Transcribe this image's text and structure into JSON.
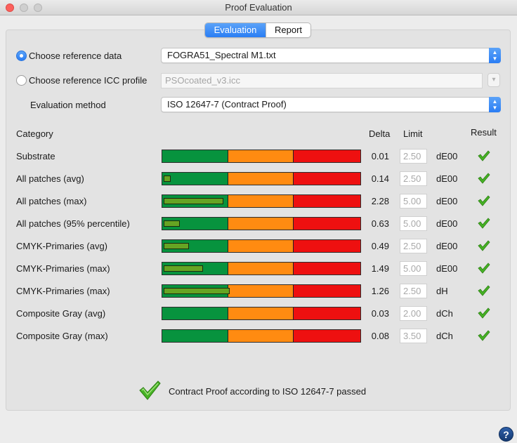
{
  "window": {
    "title": "Proof Evaluation"
  },
  "tabs": [
    {
      "label": "Evaluation",
      "active": true
    },
    {
      "label": "Report",
      "active": false
    }
  ],
  "reference": {
    "data_label": "Choose reference data",
    "data_value": "FOGRA51_Spectral M1.txt",
    "icc_label": "Choose reference ICC profile",
    "icc_value": "PSOcoated_v3.icc",
    "method_label": "Evaluation method",
    "method_value": "ISO 12647-7 (Contract Proof)"
  },
  "table": {
    "headers": {
      "category": "Category",
      "delta": "Delta",
      "limit": "Limit",
      "result": "Result"
    },
    "rows": [
      {
        "category": "Substrate",
        "delta": "0.01",
        "limit": "2.50",
        "unit": "dE00",
        "level": 0.0
      },
      {
        "category": "All patches (avg)",
        "delta": "0.14",
        "limit": "2.50",
        "unit": "dE00",
        "level": 0.034
      },
      {
        "category": "All patches (max)",
        "delta": "2.28",
        "limit": "5.00",
        "unit": "dE00",
        "level": 0.3
      },
      {
        "category": "All patches (95% percentile)",
        "delta": "0.63",
        "limit": "5.00",
        "unit": "dE00",
        "level": 0.083
      },
      {
        "category": "CMYK-Primaries (avg)",
        "delta": "0.49",
        "limit": "2.50",
        "unit": "dE00",
        "level": 0.129
      },
      {
        "category": "CMYK-Primaries (max)",
        "delta": "1.49",
        "limit": "5.00",
        "unit": "dE00",
        "level": 0.197
      },
      {
        "category": "CMYK-Primaries (max)",
        "delta": "1.26",
        "limit": "2.50",
        "unit": "dH",
        "level": 0.332
      },
      {
        "category": "Composite Gray (avg)",
        "delta": "0.03",
        "limit": "2.00",
        "unit": "dCh",
        "level": 0.0
      },
      {
        "category": "Composite Gray (max)",
        "delta": "0.08",
        "limit": "3.50",
        "unit": "dCh",
        "level": 0.0
      }
    ]
  },
  "summary": {
    "text": "Contract Proof according to ISO 12647-7 passed"
  },
  "help": {
    "label": "?"
  },
  "colors": {
    "accent": "#2a7df4",
    "zone_pass": "#07933e",
    "zone_warn": "#ff8b11",
    "zone_fail": "#ee1010",
    "measure": "#66a423",
    "check": "#47b325"
  },
  "icons": {
    "result": "checkmark-icon",
    "help": "help-icon"
  }
}
